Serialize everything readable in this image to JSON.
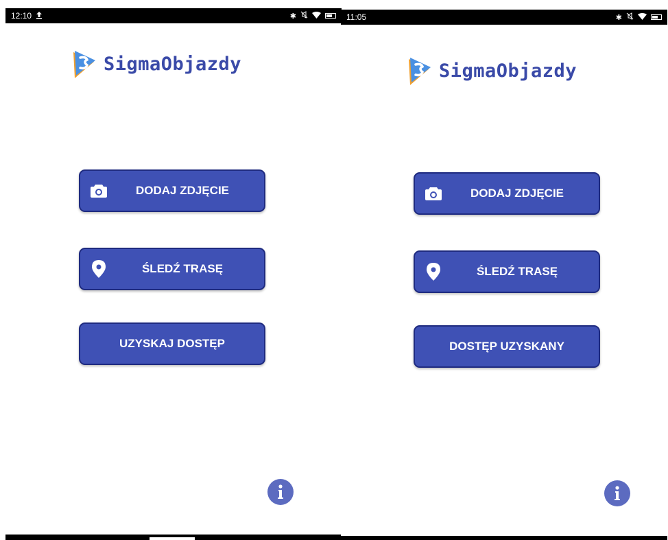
{
  "screens": [
    {
      "status_bar": {
        "time": "12:10",
        "notification_icon": "upload-icon",
        "right_icons": [
          "bluetooth-icon",
          "mute-icon",
          "wifi-icon",
          "battery-icon"
        ]
      },
      "logo": {
        "text": "SigmaObjazdy"
      },
      "buttons": {
        "add_photo": {
          "label": "DODAJ ZDJĘCIE",
          "icon": "camera-icon"
        },
        "track_route": {
          "label": "ŚLEDŹ TRASĘ",
          "icon": "location-pin-icon"
        },
        "access": {
          "label": "UZYSKAJ DOSTĘP"
        }
      },
      "info_button": {
        "icon": "info-icon"
      }
    },
    {
      "status_bar": {
        "time": "11:05",
        "right_icons": [
          "bluetooth-icon",
          "mute-icon",
          "wifi-icon",
          "battery-icon"
        ]
      },
      "logo": {
        "text": "SigmaObjazdy"
      },
      "buttons": {
        "add_photo": {
          "label": "DODAJ ZDJĘCIE",
          "icon": "camera-icon"
        },
        "track_route": {
          "label": "ŚLEDŹ TRASĘ",
          "icon": "location-pin-icon"
        },
        "access": {
          "label": "DOSTĘP UZYSKANY"
        }
      },
      "info_button": {
        "icon": "info-icon"
      }
    }
  ],
  "colors": {
    "button_fill": "#3f51b5",
    "button_border": "#1f2b80",
    "logo_text": "#3a4aa8",
    "info_button": "#5c6bc0",
    "logo_blue": "#4a90e2",
    "logo_orange": "#f0a030"
  }
}
